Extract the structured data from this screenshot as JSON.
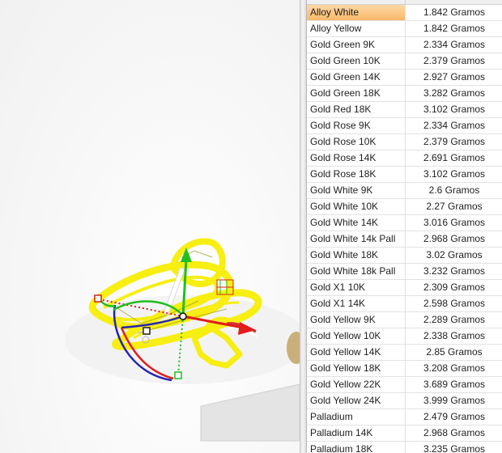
{
  "materials": [
    {
      "name": "Alloy White",
      "weight": "1.842 Gramos"
    },
    {
      "name": "Alloy Yellow",
      "weight": "1.842 Gramos"
    },
    {
      "name": "Gold Green 9K",
      "weight": "2.334 Gramos"
    },
    {
      "name": "Gold Green 10K",
      "weight": "2.379 Gramos"
    },
    {
      "name": "Gold Green 14K",
      "weight": "2.927 Gramos"
    },
    {
      "name": "Gold Green 18K",
      "weight": "3.282 Gramos"
    },
    {
      "name": "Gold Red 18K",
      "weight": "3.102 Gramos"
    },
    {
      "name": "Gold Rose 9K",
      "weight": "2.334 Gramos"
    },
    {
      "name": "Gold Rose 10K",
      "weight": "2.379 Gramos"
    },
    {
      "name": "Gold Rose 14K",
      "weight": "2.691 Gramos"
    },
    {
      "name": "Gold Rose 18K",
      "weight": "3.102 Gramos"
    },
    {
      "name": "Gold White 9K",
      "weight": "2.6 Gramos"
    },
    {
      "name": "Gold White 10K",
      "weight": "2.27 Gramos"
    },
    {
      "name": "Gold White 14K",
      "weight": "3.016 Gramos"
    },
    {
      "name": "Gold White 14k Pall",
      "weight": "2.968 Gramos"
    },
    {
      "name": "Gold White 18K",
      "weight": "3.02 Gramos"
    },
    {
      "name": "Gold White 18k Pall",
      "weight": "3.232 Gramos"
    },
    {
      "name": "Gold X1 10K",
      "weight": "2.309 Gramos"
    },
    {
      "name": "Gold X1 14K",
      "weight": "2.598 Gramos"
    },
    {
      "name": "Gold Yellow 9K",
      "weight": "2.289 Gramos"
    },
    {
      "name": "Gold Yellow 10K",
      "weight": "2.338 Gramos"
    },
    {
      "name": "Gold Yellow 14K",
      "weight": "2.85 Gramos"
    },
    {
      "name": "Gold Yellow 18K",
      "weight": "3.208 Gramos"
    },
    {
      "name": "Gold Yellow 22K",
      "weight": "3.689 Gramos"
    },
    {
      "name": "Gold Yellow 24K",
      "weight": "3.999 Gramos"
    },
    {
      "name": "Palladium",
      "weight": "2.479 Gramos"
    },
    {
      "name": "Palladium 14K",
      "weight": "2.968 Gramos"
    },
    {
      "name": "Palladium 18K",
      "weight": "3.235 Gramos"
    }
  ],
  "selected_row": 0,
  "colors": {
    "object_yellow": "#f7ee12",
    "gizmo_red": "#e31b1b",
    "gizmo_green": "#1fbf1f",
    "gizmo_blue": "#2424b8",
    "selection_highlight": "#f7b868"
  }
}
